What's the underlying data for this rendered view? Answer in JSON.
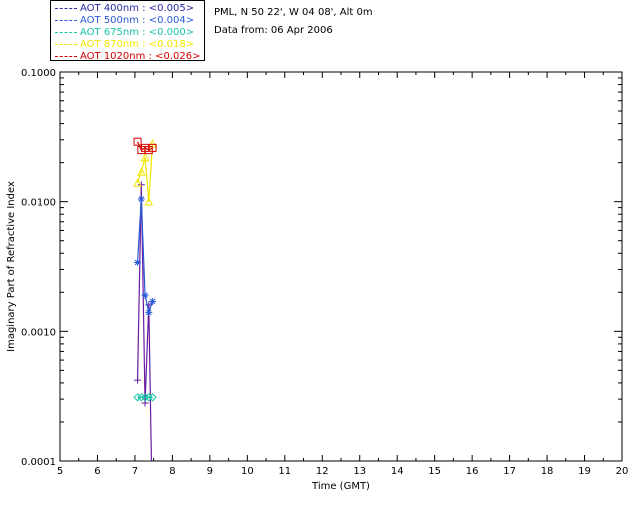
{
  "header": {
    "site": "PML, N 50 22', W 04 08', Alt 0m",
    "date": "Data from: 06 Apr 2006"
  },
  "legend": [
    {
      "label": "AOT  400nm : <0.005>",
      "color": "#2a2aa8"
    },
    {
      "label": "AOT  500nm : <0.004>",
      "color": "#2a5bd7"
    },
    {
      "label": "AOT  675nm : <0.000>",
      "color": "#19c7a6"
    },
    {
      "label": "AOT  870nm : <0.018>",
      "color": "#f2e600"
    },
    {
      "label": "AOT 1020nm : <0.026>",
      "color": "#d40000"
    }
  ],
  "chart_data": {
    "type": "line",
    "xlabel": "Time (GMT)",
    "ylabel": "Imaginary Part of Refractive Index",
    "xlim": [
      5,
      20
    ],
    "ylim": [
      0.0001,
      0.1
    ],
    "yscale": "log",
    "xticks": [
      "5",
      "6",
      "7",
      "8",
      "9",
      "10",
      "11",
      "12",
      "13",
      "14",
      "15",
      "16",
      "17",
      "18",
      "19",
      "20"
    ],
    "yticks": [
      "0.0001",
      "0.0010",
      "0.0100",
      "0.1000"
    ],
    "series": [
      {
        "name": "AOT  400nm : <0.005>",
        "color": "#6a1aa0",
        "marker": "plus",
        "x": [
          7.07,
          7.17,
          7.27,
          7.37,
          7.47
        ],
        "y": [
          0.00042,
          0.0135,
          0.00028,
          0.0016,
          3e-05
        ]
      },
      {
        "name": "AOT  500nm : <0.004>",
        "color": "#2a5bd7",
        "marker": "asterisk",
        "x": [
          7.07,
          7.17,
          7.27,
          7.37,
          7.47
        ],
        "y": [
          0.0034,
          0.0105,
          0.0019,
          0.0014,
          0.0017
        ]
      },
      {
        "name": "AOT  675nm : <0.000>",
        "color": "#19c7a6",
        "marker": "diamond",
        "x": [
          7.07,
          7.17,
          7.27,
          7.37,
          7.47
        ],
        "y": [
          0.00031,
          0.00031,
          0.00031,
          0.00031,
          0.00031
        ]
      },
      {
        "name": "AOT  870nm : <0.018>",
        "color": "#f2e600",
        "marker": "triangle",
        "x": [
          7.07,
          7.17,
          7.27,
          7.37,
          7.47
        ],
        "y": [
          0.014,
          0.017,
          0.022,
          0.01,
          0.028
        ]
      },
      {
        "name": "AOT 1020nm : <0.026>",
        "color": "#d40000",
        "marker": "square",
        "x": [
          7.07,
          7.17,
          7.27,
          7.37,
          7.47
        ],
        "y": [
          0.029,
          0.025,
          0.026,
          0.025,
          0.026
        ]
      }
    ]
  }
}
